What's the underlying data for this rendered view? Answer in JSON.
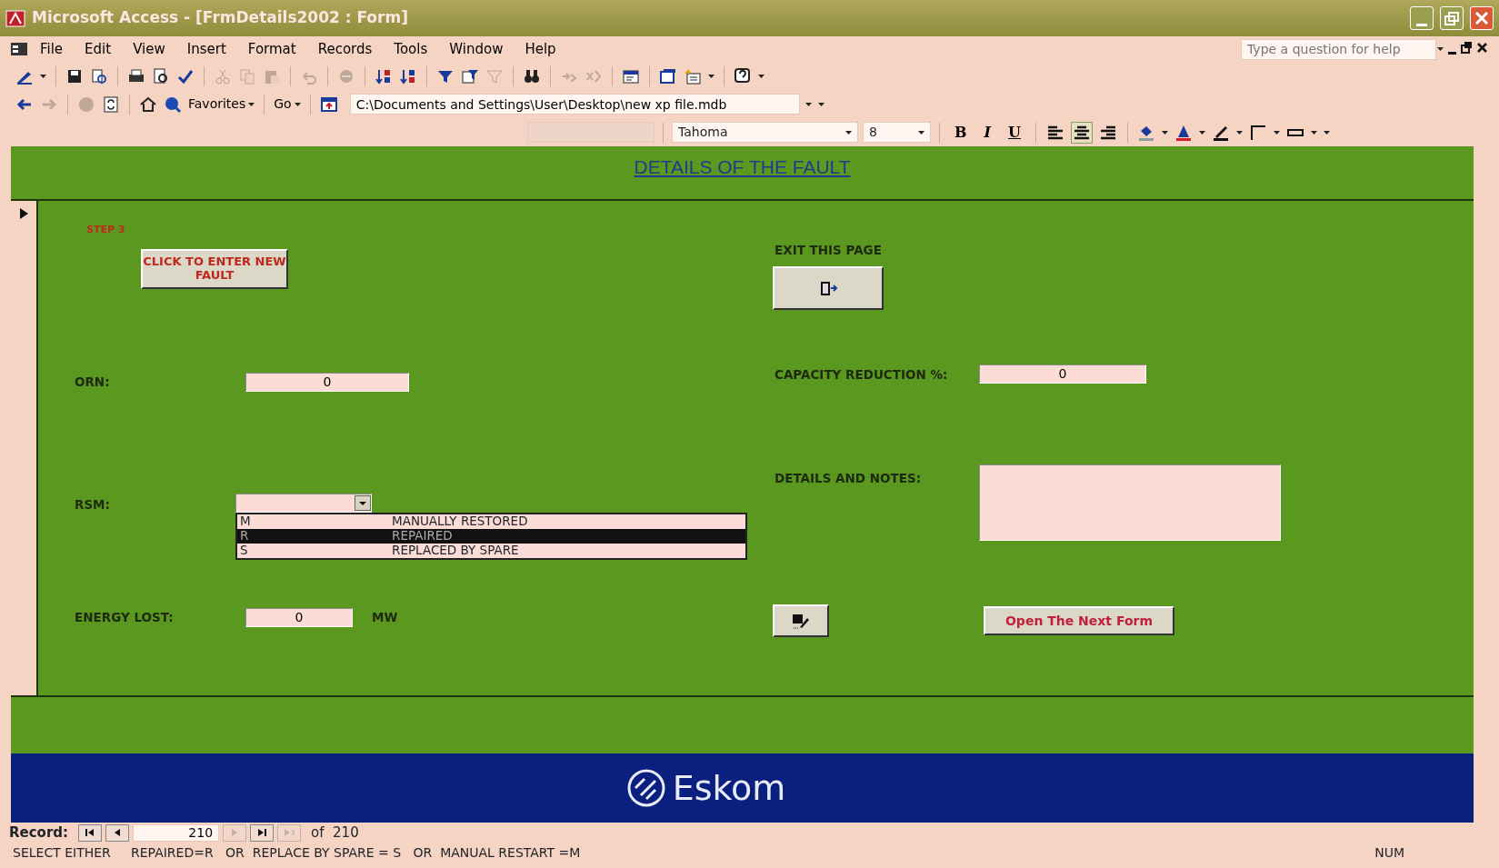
{
  "window": {
    "title": "Microsoft Access - [FrmDetails2002 : Form]"
  },
  "menu": [
    "File",
    "Edit",
    "View",
    "Insert",
    "Format",
    "Records",
    "Tools",
    "Window",
    "Help"
  ],
  "help_box": {
    "placeholder": "Type a question for help"
  },
  "web_toolbar": {
    "favorites": "Favorites",
    "go": "Go",
    "address": "C:\\Documents and Settings\\User\\Desktop\\new xp file.mdb"
  },
  "format_toolbar": {
    "font": "Tahoma",
    "size": "8",
    "bold": "B",
    "italic": "I",
    "underline": "U",
    "alignments": [
      {
        "selected": false
      },
      {
        "selected": true
      },
      {
        "selected": false
      }
    ]
  },
  "form": {
    "title": "DETAILS OF THE FAULT",
    "step": "STEP 3",
    "new_fault_button": "CLICK TO ENTER NEW FAULT",
    "exit_label": "EXIT THIS PAGE",
    "orn": {
      "label": "ORN:",
      "value": "0"
    },
    "capacity": {
      "label": "CAPACITY REDUCTION %:",
      "value": "0"
    },
    "details": {
      "label": "DETAILS AND NOTES:"
    },
    "rsm": {
      "label": "RSM:",
      "options": [
        {
          "code": "M",
          "description": "MANUALLY RESTORED",
          "selected": false
        },
        {
          "code": "R",
          "description": "REPAIRED",
          "selected": true
        },
        {
          "code": "S",
          "description": "REPLACED BY SPARE",
          "selected": false
        }
      ]
    },
    "energy": {
      "label": "ENERGY LOST:",
      "value": "0",
      "unit": "MW"
    },
    "next_form_button": "Open The Next Form",
    "logo": "Eskom"
  },
  "record_nav": {
    "label": "Record:",
    "current": "210",
    "total": "of  210"
  },
  "status_bar": {
    "message": "SELECT EITHER     REPAIRED=R   OR  REPLACE BY SPARE = S   OR  MANUAL RESTART =M",
    "indicator": "NUM"
  }
}
